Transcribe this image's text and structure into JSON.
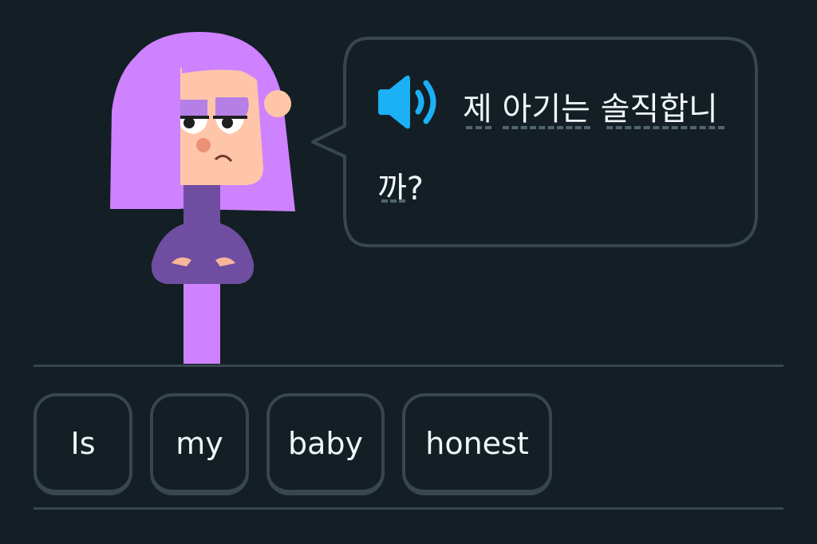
{
  "prompt": {
    "sentence_line1": "제 아기는 솔직합니",
    "sentence_line2": "까?"
  },
  "word_bank": [
    {
      "label": "Is"
    },
    {
      "label": "my"
    },
    {
      "label": "baby"
    },
    {
      "label": "honest"
    }
  ],
  "colors": {
    "background": "#131f24",
    "border": "#37464f",
    "speaker": "#1cb0f6",
    "character_hair": "#ce82ff",
    "character_shirt": "#6f4ea1",
    "text": "#f1f7fb"
  },
  "icons": {
    "speaker": "speaker-icon"
  }
}
